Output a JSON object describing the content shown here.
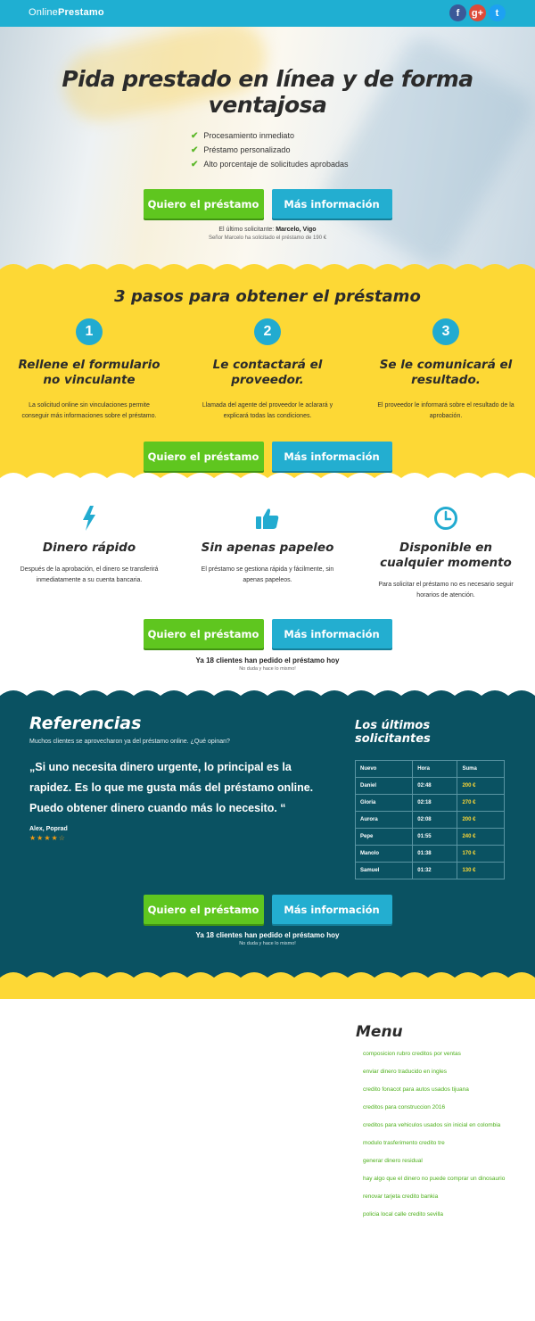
{
  "header": {
    "logo_light": "Online",
    "logo_bold": "Prestamo",
    "social": [
      {
        "name": "facebook",
        "glyph": "f"
      },
      {
        "name": "google-plus",
        "glyph": "g+"
      },
      {
        "name": "twitter",
        "glyph": "t"
      }
    ]
  },
  "hero": {
    "title": "Pida prestado en línea y de forma ventajosa",
    "checks": [
      "Procesamiento inmediato",
      "Préstamo personalizado",
      "Alto porcentaje de solicitudes aprobadas"
    ],
    "last_label": "El último solicitante:",
    "last_name": "Marcelo, Vigo",
    "last_sub": "Señor Marcelo ha solicitado el préstamo de 190 €"
  },
  "buttons": {
    "primary": "Quiero el préstamo",
    "secondary": "Más información"
  },
  "steps": {
    "title": "3 pasos para obtener el préstamo",
    "items": [
      {
        "num": "1",
        "title": "Rellene el formulario no vinculante",
        "text": "La solicitud online sin vinculaciones permite conseguir más informaciones sobre el préstamo."
      },
      {
        "num": "2",
        "title": "Le contactará el proveedor.",
        "text": "Llamada del agente del proveedor le aclarará y explicará todas las condiciones."
      },
      {
        "num": "3",
        "title": "Se le comunicará el resultado.",
        "text": "El proveedor le informará sobre el resultado de la aprobación."
      }
    ]
  },
  "features": {
    "items": [
      {
        "icon": "lightning-icon",
        "title": "Dinero rápido",
        "text": "Después de la aprobación, el dinero se transferirá inmediatamente a su cuenta bancaria."
      },
      {
        "icon": "thumbs-up-icon",
        "title": "Sin apenas papeleo",
        "text": "El préstamo se gestiona rápida y fácilmente, sin apenas papeleos."
      },
      {
        "icon": "clock-icon",
        "title": "Disponible en cualquier momento",
        "text": "Para solicitar el préstamo no es necesario seguir horarios de atención."
      }
    ],
    "already": "Ya 18 clientes han pedido el préstamo hoy",
    "already_sub": "No duda y hace lo mismo!"
  },
  "references": {
    "title": "Referencias",
    "intro": "Muchos clientes se aprovecharon ya del préstamo online. ¿Qué opinan?",
    "quote": "„Si uno necesita dinero urgente, lo principal es la rapidez. Es lo que me gusta más del préstamo online. Puedo obtener dinero cuando más lo necesito. “",
    "author": "Alex, Poprad",
    "stars": "★★★★☆",
    "rating": 4.5,
    "already": "Ya 18 clientes han pedido el préstamo hoy",
    "already_sub": "No duda y hace lo mismo!"
  },
  "applicants": {
    "title": "Los últimos solicitantes",
    "columns": [
      "Nuevo",
      "Hora",
      "Suma"
    ],
    "rows": [
      [
        "Daniel",
        "02:48",
        "200 €"
      ],
      [
        "Gloria",
        "02:18",
        "270 €"
      ],
      [
        "Aurora",
        "02:08",
        "200 €"
      ],
      [
        "Pepe",
        "01:55",
        "240 €"
      ],
      [
        "Manolo",
        "01:38",
        "170 €"
      ],
      [
        "Samuel",
        "01:32",
        "130 €"
      ]
    ]
  },
  "menu": {
    "title": "Menu",
    "items": [
      "composicion rubro creditos por ventas",
      "enviar dinero traducido en ingles",
      "credito fonacot para autos usados tijuana",
      "creditos para construccion 2016",
      "creditos para vehiculos usados sin inicial en colombia",
      "modulo trasferimento credito tre",
      "generar dinero residual",
      "hay algo que el dinero no puede comprar un dinosaurio",
      "renovar tarjeta credito bankia",
      "policia local calle credito sevilla"
    ]
  },
  "colors": {
    "header": "#1fafd2",
    "yellow": "#fdd835",
    "teal": "#0a5262",
    "green_button": "#5fc61f",
    "blue_button": "#23aed0"
  }
}
